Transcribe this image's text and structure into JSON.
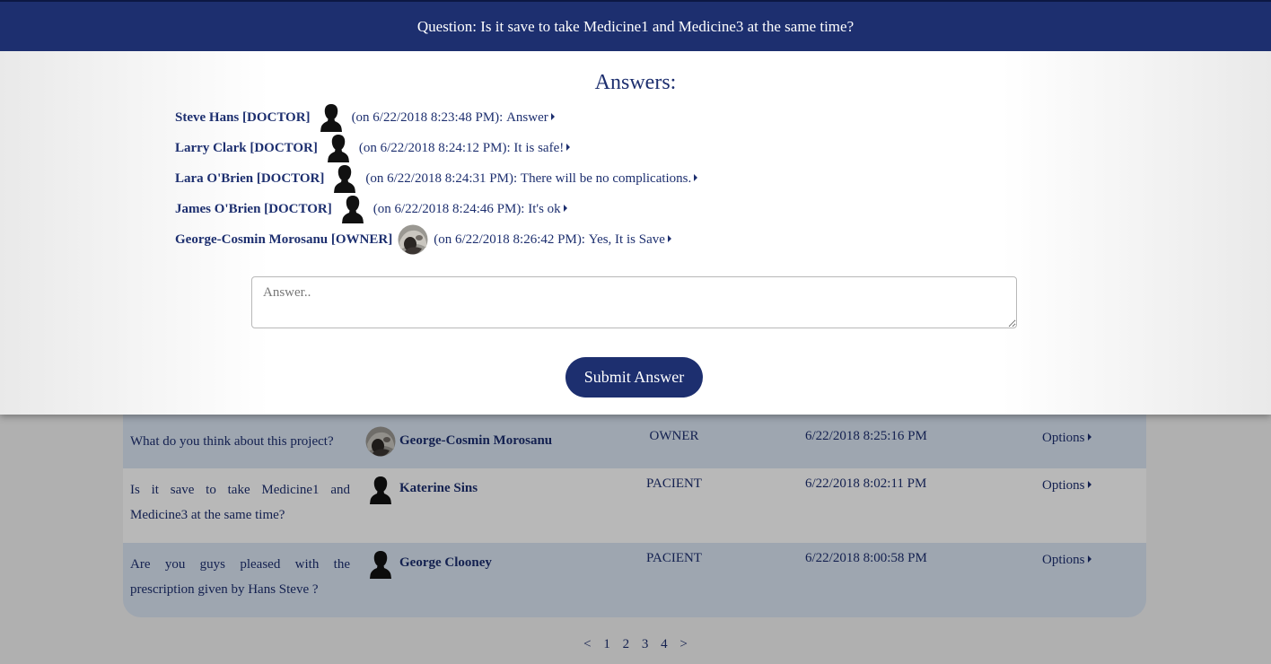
{
  "modal": {
    "header_title": "Question: Is it save to take Medicine1 and Medicine3 at the same time?",
    "answers_title": "Answers:",
    "answers": [
      {
        "author": "Steve Hans [DOCTOR]",
        "avatar": "silhouette-avatar",
        "time": "(on 6/22/2018 8:23:48 PM):",
        "text": "Answer"
      },
      {
        "author": "Larry Clark [DOCTOR]",
        "avatar": "silhouette-avatar",
        "time": "(on 6/22/2018 8:24:12 PM):",
        "text": "It is safe!"
      },
      {
        "author": "Lara O'Brien [DOCTOR]",
        "avatar": "silhouette-avatar",
        "time": "(on 6/22/2018 8:24:31 PM):",
        "text": "There will be no complications."
      },
      {
        "author": "James O'Brien [DOCTOR]",
        "avatar": "silhouette-avatar",
        "time": "(on 6/22/2018 8:24:46 PM):",
        "text": "It's ok"
      },
      {
        "author": "George-Cosmin Morosanu [OWNER]",
        "avatar": "photo-avatar",
        "time": "(on 6/22/2018 8:26:42 PM):",
        "text": "Yes, It is Save"
      }
    ],
    "answer_input": {
      "placeholder": "Answer..",
      "value": ""
    },
    "submit_label": "Submit Answer"
  },
  "questions": [
    {
      "text": "What do you think about this project?",
      "author": "George-Cosmin Morosanu",
      "avatar": "photo-avatar",
      "role": "OWNER",
      "date": "6/22/2018 8:25:16 PM",
      "options_label": "Options"
    },
    {
      "text": "Is it save to take Medicine1 and Medicine3 at the same time?",
      "author": "Katerine Sins",
      "avatar": "silhouette-avatar",
      "role": "PACIENT",
      "date": "6/22/2018 8:02:11 PM",
      "options_label": "Options"
    },
    {
      "text": "Are you guys pleased with the prescription given by Hans Steve ?",
      "author": "George Clooney",
      "avatar": "silhouette-avatar",
      "role": "PACIENT",
      "date": "6/22/2018 8:00:58 PM",
      "options_label": "Options"
    }
  ],
  "pagination": {
    "prev": "<",
    "pages": [
      "1",
      "2",
      "3",
      "4"
    ],
    "next": ">"
  },
  "colors": {
    "primary": "#1d2f6f",
    "row_alt": "#dbe6f4"
  }
}
